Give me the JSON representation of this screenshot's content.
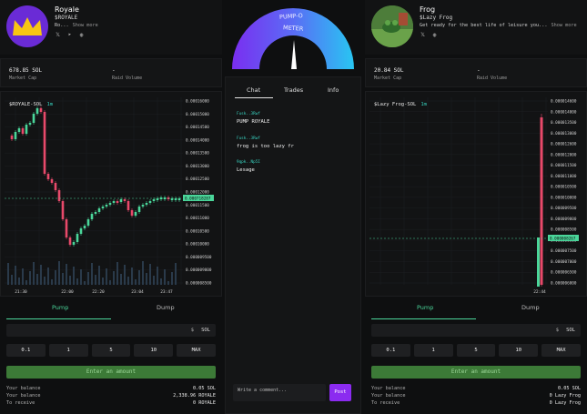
{
  "left": {
    "name": "Royale",
    "ticker": "$ROYALE",
    "desc": "Ro...",
    "show_more": "Show more",
    "socials": [
      "𝕏",
      "➤",
      "◍"
    ],
    "market_cap_value": "678.85 SOL",
    "market_cap_label": "Market Cap",
    "raised_value": "-",
    "raised_label": "Raid Volume",
    "pair": "$ROYALE-SOL",
    "timeframe": "1m",
    "price_tag": "0.000718287",
    "y_ticks": [
      "0.00016000",
      "0.00015000",
      "0.00014500",
      "0.00014000",
      "0.00013500",
      "0.00013000",
      "0.00012500",
      "0.00012000",
      "0.00011500",
      "0.00011000",
      "0.00010500",
      "0.00010000",
      "0.000009500",
      "0.000009000",
      "0.000008500"
    ],
    "x_ticks": [
      "21:30",
      "22:00",
      "22:20",
      "23:04",
      "23:47"
    ],
    "tab_pump": "Pump",
    "tab_dump": "Dump",
    "amount_symbol": "$",
    "amount_currency": "SOL",
    "presets": [
      "0.1",
      "1",
      "5",
      "10",
      "MAX"
    ],
    "enter_label": "Enter an amount",
    "balances": [
      {
        "label": "Your balance",
        "value": "0.05 SOL"
      },
      {
        "label": "Your balance",
        "value": "2,338.96 ROYALE"
      },
      {
        "label": "To receive",
        "value": "0 ROYALE"
      }
    ]
  },
  "center": {
    "meter_label_1": "PUMP-O",
    "meter_label_2": "METER",
    "tabs": [
      "Chat",
      "Trades",
      "Info"
    ],
    "messages": [
      {
        "user": "Fusk..3Rwf",
        "text": "PUMP ROYALE"
      },
      {
        "user": "Fusk..3Rwf",
        "text": "frog is too lazy fr"
      },
      {
        "user": "9qpk..Np5I",
        "text": "Lesage"
      }
    ],
    "comment_placeholder": "Write a comment...",
    "post_label": "Post"
  },
  "right": {
    "name": "Frog",
    "ticker": "$Lazy Frog",
    "desc": "Get ready for the best life of leisure you...",
    "show_more": "Show more",
    "socials": [
      "𝕏",
      "◍"
    ],
    "market_cap_value": "20.84 SOL",
    "market_cap_label": "Market Cap",
    "raised_value": "-",
    "raised_label": "Raid Volume",
    "pair": "$Lazy Frog-SOL",
    "timeframe": "1m",
    "price_tag": "0.000008267",
    "y_ticks": [
      "0.000014600",
      "0.000014000",
      "0.000013500",
      "0.000013000",
      "0.000012600",
      "0.000012000",
      "0.000011500",
      "0.000011000",
      "0.000010500",
      "0.000010000",
      "0.000009500",
      "0.000009000",
      "0.000008500",
      "0.000008000",
      "0.000007500",
      "0.000007000",
      "0.000006500",
      "0.000006000"
    ],
    "x_ticks": [
      "22:44"
    ],
    "tab_pump": "Pump",
    "tab_dump": "Dump",
    "amount_symbol": "$",
    "amount_currency": "SOL",
    "presets": [
      "0.1",
      "1",
      "5",
      "10",
      "MAX"
    ],
    "enter_label": "Enter an amount",
    "balances": [
      {
        "label": "Your balance",
        "value": "0.05 SOL"
      },
      {
        "label": "Your balance",
        "value": "0 Lazy Frog"
      },
      {
        "label": "To receive",
        "value": "0 Lazy Frog"
      }
    ]
  },
  "colors": {
    "up": "#4ad69a",
    "down": "#e8496a",
    "accent": "#38d3c0",
    "post": "#8b2bf0",
    "enter": "#3c7a37"
  }
}
